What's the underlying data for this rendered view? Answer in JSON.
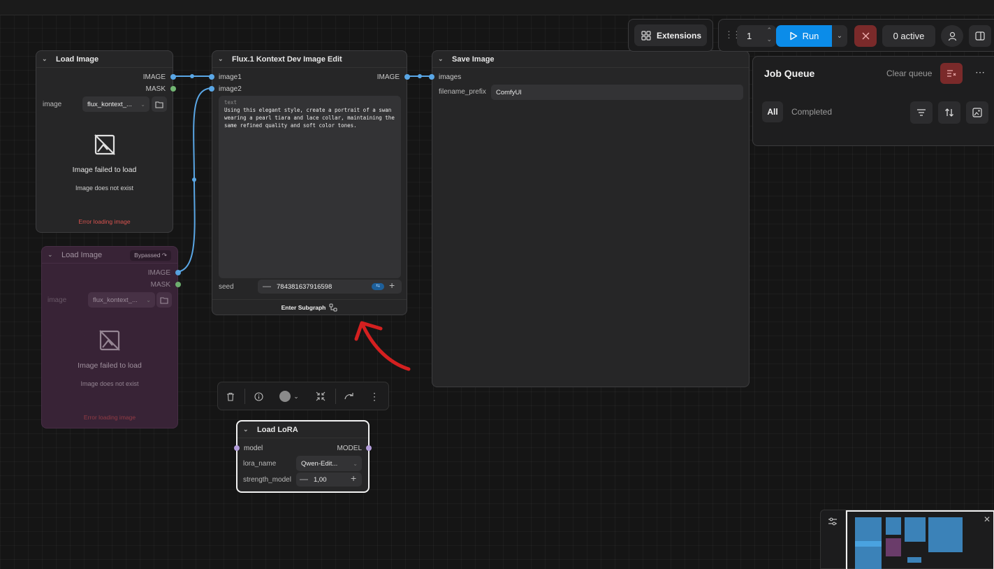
{
  "colors": {
    "accent": "#0b8ce9",
    "link": "#5aa7e6",
    "danger": "#7a2a2a",
    "bypass": "#3a2438",
    "error": "#d9534f"
  },
  "topbar": {
    "extensions_label": "Extensions",
    "batch_count": "1",
    "run_label": "Run",
    "active_label": "0 active"
  },
  "job_queue": {
    "title": "Job Queue",
    "clear_label": "Clear queue",
    "tab_all": "All",
    "tab_completed": "Completed"
  },
  "nodes": {
    "load_image_1": {
      "title": "Load Image",
      "out_image": "IMAGE",
      "out_mask": "MASK",
      "widget_label": "image",
      "widget_value": "flux_kontext_...",
      "fail_title": "Image failed to load",
      "fail_sub": "Image does not exist",
      "fail_err": "Error loading image"
    },
    "load_image_2": {
      "title": "Load Image",
      "badge": "Bypassed",
      "out_image": "IMAGE",
      "out_mask": "MASK",
      "widget_label": "image",
      "widget_value": "flux_kontext_...",
      "fail_title": "Image failed to load",
      "fail_sub": "Image does not exist",
      "fail_err": "Error loading image"
    },
    "flux": {
      "title": "Flux.1 Kontext Dev Image Edit",
      "in_image1": "image1",
      "in_image2": "image2",
      "out_image": "IMAGE",
      "text_label": "text",
      "text_value": "Using this elegant style, create a portrait of a swan wearing a pearl tiara and lace collar, maintaining the same refined quality and soft color tones.",
      "seed_label": "seed",
      "seed_value": "784381637916598",
      "subgraph_label": "Enter Subgraph"
    },
    "save": {
      "title": "Save Image",
      "in_images": "images",
      "prefix_label": "filename_prefix",
      "prefix_value": "ComfyUI"
    },
    "lora": {
      "title": "Load LoRA",
      "in_model": "model",
      "out_model": "MODEL",
      "lora_label": "lora_name",
      "lora_value": "Qwen-Edit...",
      "strength_label": "strength_model",
      "strength_value": "1,00"
    }
  }
}
